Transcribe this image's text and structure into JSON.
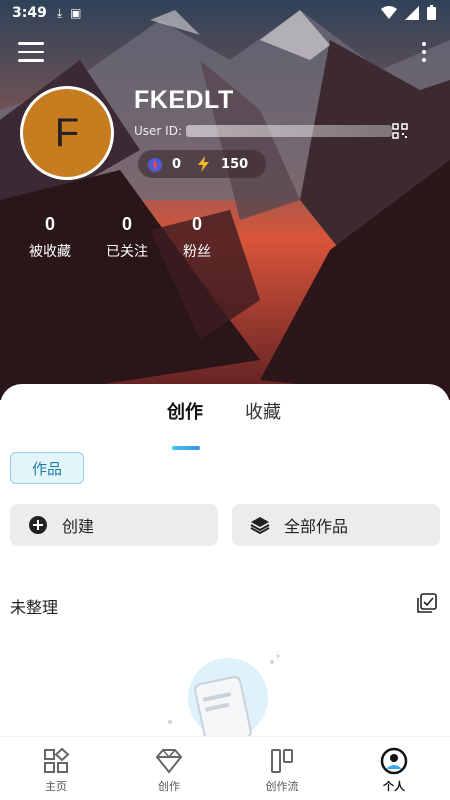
{
  "status_bar": {
    "time": "3:49"
  },
  "profile": {
    "avatar_letter": "F",
    "username": "FKEDLT",
    "user_id_label": "User ID:",
    "badge_left_value": "0",
    "badge_right_value": "150"
  },
  "stats": [
    {
      "value": "0",
      "label": "被收藏"
    },
    {
      "value": "0",
      "label": "已关注"
    },
    {
      "value": "0",
      "label": "粉丝"
    }
  ],
  "tabs": [
    {
      "label": "创作",
      "active": true
    },
    {
      "label": "收藏",
      "active": false
    }
  ],
  "filter_chip": {
    "label": "作品"
  },
  "actions": {
    "create": "创建",
    "all_works": "全部作品"
  },
  "section": {
    "title": "未整理"
  },
  "bottom_nav": [
    {
      "label": "主页",
      "icon": "grid-icon"
    },
    {
      "label": "创作",
      "icon": "diamond-icon"
    },
    {
      "label": "创作流",
      "icon": "columns-icon"
    },
    {
      "label": "个人",
      "icon": "person-icon",
      "active": true
    }
  ],
  "colors": {
    "avatar_bg": "#c87c20",
    "accent": "#3aa8f0",
    "chip_bg": "#e3f4fb"
  }
}
